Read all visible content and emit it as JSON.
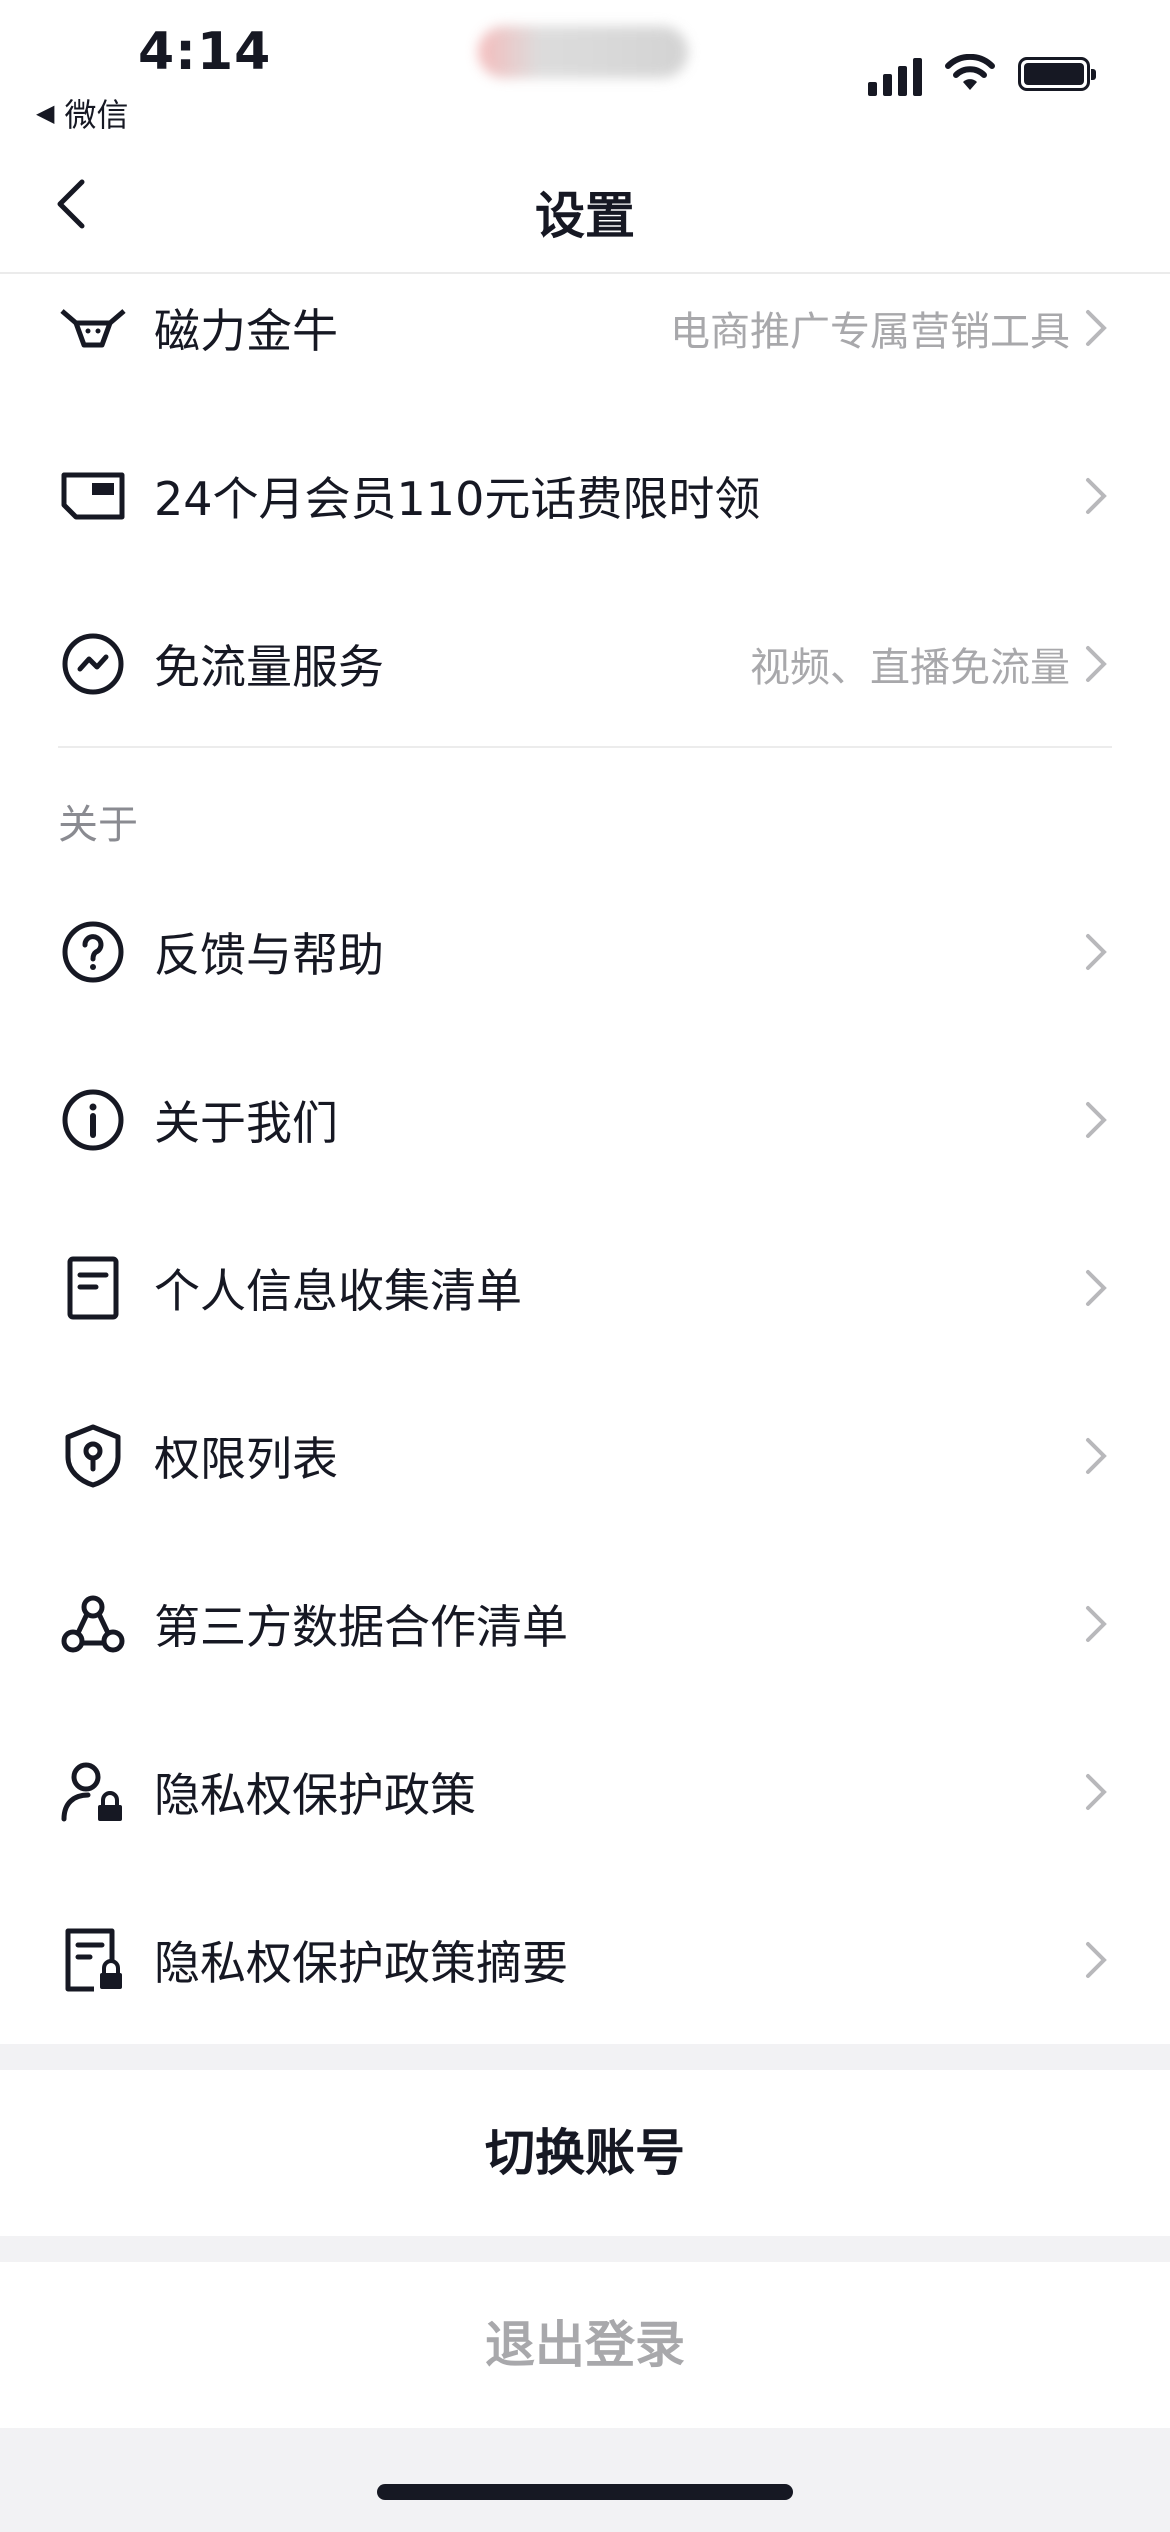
{
  "status_bar": {
    "time": "4:14",
    "back_app_label": "微信",
    "back_icon": "triangle-left-icon",
    "icons": [
      "signal-icon",
      "wifi-icon",
      "battery-icon"
    ]
  },
  "nav": {
    "title": "设置",
    "back_icon": "chevron-left-icon"
  },
  "rows_top": [
    {
      "icon": "bull-icon",
      "label": "磁力金牛",
      "sub": "电商推广专属营销工具"
    },
    {
      "icon": "card-icon",
      "label": "24个月会员110元话费限时领",
      "sub": ""
    },
    {
      "icon": "data-free-icon",
      "label": "免流量服务",
      "sub": "视频、直播免流量"
    }
  ],
  "about": {
    "section_title": "关于",
    "items": [
      {
        "icon": "question-circle-icon",
        "label": "反馈与帮助"
      },
      {
        "icon": "info-circle-icon",
        "label": "关于我们"
      },
      {
        "icon": "document-icon",
        "label": "个人信息收集清单"
      },
      {
        "icon": "shield-key-icon",
        "label": "权限列表"
      },
      {
        "icon": "network-icon",
        "label": "第三方数据合作清单"
      },
      {
        "icon": "user-lock-icon",
        "label": "隐私权保护政策"
      },
      {
        "icon": "document-lock-icon",
        "label": "隐私权保护政策摘要"
      }
    ]
  },
  "actions": {
    "switch_account": "切换账号",
    "logout": "退出登录"
  },
  "colors": {
    "text_primary": "#161823",
    "text_secondary": "#a8a8ab",
    "section_label": "#8a8b91",
    "logout_text": "#a8a8ab",
    "gap_background": "#f2f2f4"
  }
}
